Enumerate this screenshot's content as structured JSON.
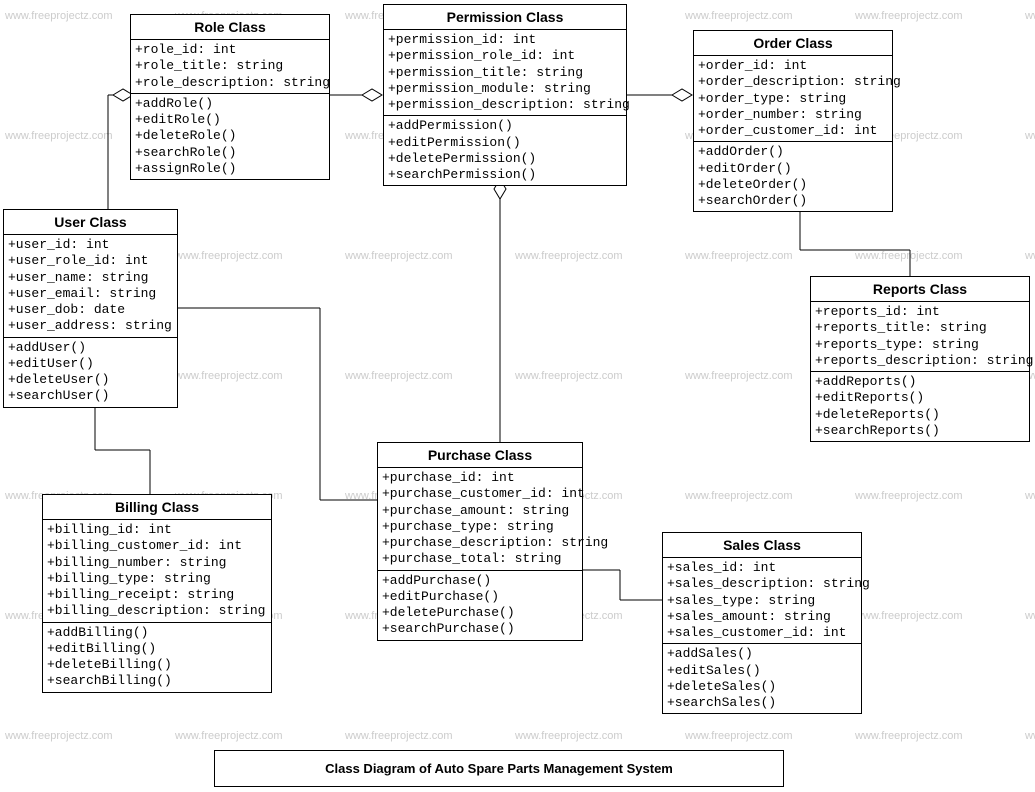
{
  "diagram_title": "Class Diagram of Auto Spare Parts Management System",
  "watermark_text": "www.freeprojectz.com",
  "classes": {
    "role": {
      "title": "Role Class",
      "attrs": [
        "+role_id: int",
        "+role_title: string",
        "+role_description: string"
      ],
      "ops": [
        "+addRole()",
        "+editRole()",
        "+deleteRole()",
        "+searchRole()",
        "+assignRole()"
      ]
    },
    "permission": {
      "title": "Permission Class",
      "attrs": [
        "+permission_id: int",
        "+permission_role_id: int",
        "+permission_title: string",
        "+permission_module: string",
        "+permission_description: string"
      ],
      "ops": [
        "+addPermission()",
        "+editPermission()",
        "+deletePermission()",
        "+searchPermission()"
      ]
    },
    "order": {
      "title": "Order Class",
      "attrs": [
        "+order_id: int",
        "+order_description: string",
        "+order_type: string",
        "+order_number: string",
        "+order_customer_id: int"
      ],
      "ops": [
        "+addOrder()",
        "+editOrder()",
        "+deleteOrder()",
        "+searchOrder()"
      ]
    },
    "user": {
      "title": "User Class",
      "attrs": [
        "+user_id: int",
        "+user_role_id: int",
        "+user_name: string",
        "+user_email: string",
        "+user_dob: date",
        "+user_address: string"
      ],
      "ops": [
        "+addUser()",
        "+editUser()",
        "+deleteUser()",
        "+searchUser()"
      ]
    },
    "reports": {
      "title": "Reports Class",
      "attrs": [
        "+reports_id: int",
        "+reports_title: string",
        "+reports_type: string",
        "+reports_description: string"
      ],
      "ops": [
        "+addReports()",
        "+editReports()",
        "+deleteReports()",
        "+searchReports()"
      ]
    },
    "purchase": {
      "title": "Purchase Class",
      "attrs": [
        "+purchase_id: int",
        "+purchase_customer_id: int",
        "+purchase_amount: string",
        "+purchase_type: string",
        "+purchase_description: string",
        "+purchase_total: string"
      ],
      "ops": [
        "+addPurchase()",
        "+editPurchase()",
        "+deletePurchase()",
        "+searchPurchase()"
      ]
    },
    "billing": {
      "title": "Billing Class",
      "attrs": [
        "+billing_id: int",
        "+billing_customer_id: int",
        "+billing_number: string",
        "+billing_type: string",
        "+billing_receipt: string",
        "+billing_description: string"
      ],
      "ops": [
        "+addBilling()",
        "+editBilling()",
        "+deleteBilling()",
        "+searchBilling()"
      ]
    },
    "sales": {
      "title": "Sales Class",
      "attrs": [
        "+sales_id: int",
        "+sales_description: string",
        "+sales_type: string",
        "+sales_amount: string",
        "+sales_customer_id: int"
      ],
      "ops": [
        "+addSales()",
        "+editSales()",
        "+deleteSales()",
        "+searchSales()"
      ]
    }
  },
  "chart_data": {
    "type": "uml-class-diagram",
    "title": "Class Diagram of Auto Spare Parts Management System",
    "classes": [
      {
        "name": "Role Class",
        "attributes": [
          "role_id: int",
          "role_title: string",
          "role_description: string"
        ],
        "operations": [
          "addRole()",
          "editRole()",
          "deleteRole()",
          "searchRole()",
          "assignRole()"
        ]
      },
      {
        "name": "Permission Class",
        "attributes": [
          "permission_id: int",
          "permission_role_id: int",
          "permission_title: string",
          "permission_module: string",
          "permission_description: string"
        ],
        "operations": [
          "addPermission()",
          "editPermission()",
          "deletePermission()",
          "searchPermission()"
        ]
      },
      {
        "name": "Order Class",
        "attributes": [
          "order_id: int",
          "order_description: string",
          "order_type: string",
          "order_number: string",
          "order_customer_id: int"
        ],
        "operations": [
          "addOrder()",
          "editOrder()",
          "deleteOrder()",
          "searchOrder()"
        ]
      },
      {
        "name": "User Class",
        "attributes": [
          "user_id: int",
          "user_role_id: int",
          "user_name: string",
          "user_email: string",
          "user_dob: date",
          "user_address: string"
        ],
        "operations": [
          "addUser()",
          "editUser()",
          "deleteUser()",
          "searchUser()"
        ]
      },
      {
        "name": "Reports Class",
        "attributes": [
          "reports_id: int",
          "reports_title: string",
          "reports_type: string",
          "reports_description: string"
        ],
        "operations": [
          "addReports()",
          "editReports()",
          "deleteReports()",
          "searchReports()"
        ]
      },
      {
        "name": "Purchase Class",
        "attributes": [
          "purchase_id: int",
          "purchase_customer_id: int",
          "purchase_amount: string",
          "purchase_type: string",
          "purchase_description: string",
          "purchase_total: string"
        ],
        "operations": [
          "addPurchase()",
          "editPurchase()",
          "deletePurchase()",
          "searchPurchase()"
        ]
      },
      {
        "name": "Billing Class",
        "attributes": [
          "billing_id: int",
          "billing_customer_id: int",
          "billing_number: string",
          "billing_type: string",
          "billing_receipt: string",
          "billing_description: string"
        ],
        "operations": [
          "addBilling()",
          "editBilling()",
          "deleteBilling()",
          "searchBilling()"
        ]
      },
      {
        "name": "Sales Class",
        "attributes": [
          "sales_id: int",
          "sales_description: string",
          "sales_type: string",
          "sales_amount: string",
          "sales_customer_id: int"
        ],
        "operations": [
          "addSales()",
          "editSales()",
          "deleteSales()",
          "searchSales()"
        ]
      }
    ],
    "relationships": [
      {
        "from": "User Class",
        "to": "Role Class",
        "type": "aggregation",
        "diamond_at": "Role Class"
      },
      {
        "from": "Role Class",
        "to": "Permission Class",
        "type": "aggregation",
        "diamond_at": "Permission Class"
      },
      {
        "from": "Permission Class",
        "to": "Order Class",
        "type": "aggregation",
        "diamond_at": "Order Class"
      },
      {
        "from": "Permission Class",
        "to": "Purchase Class",
        "type": "aggregation",
        "diamond_at": "Permission Class"
      },
      {
        "from": "User Class",
        "to": "Purchase Class",
        "type": "association"
      },
      {
        "from": "User Class",
        "to": "Billing Class",
        "type": "association"
      },
      {
        "from": "Order Class",
        "to": "Reports Class",
        "type": "association"
      },
      {
        "from": "Purchase Class",
        "to": "Sales Class",
        "type": "association"
      }
    ]
  }
}
